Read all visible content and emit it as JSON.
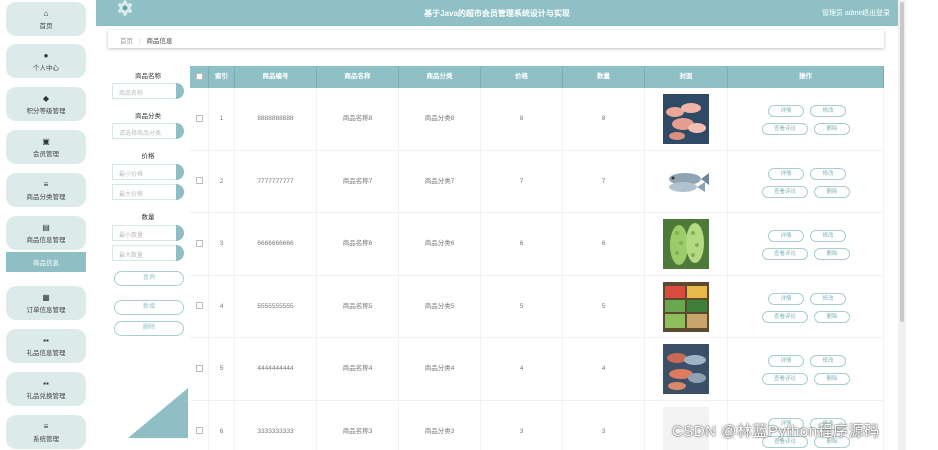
{
  "header": {
    "title": "基于Java的超市会员管理系统设计与实现",
    "user": "管理员 admin",
    "logout": "退出登录"
  },
  "sidebar": {
    "items": [
      {
        "icon": "home-icon",
        "glyph": "⌂",
        "label": "首页"
      },
      {
        "icon": "user-icon",
        "glyph": "●",
        "label": "个人中心"
      },
      {
        "icon": "points-icon",
        "glyph": "◆",
        "label": "积分等级管理"
      },
      {
        "icon": "member-icon",
        "glyph": "▣",
        "label": "会员管理"
      },
      {
        "icon": "list-icon",
        "glyph": "≡",
        "label": "商品分类管理"
      },
      {
        "icon": "goods-icon",
        "glyph": "▤",
        "label": "商品信息管理"
      },
      {
        "icon": "order-icon",
        "glyph": "▦",
        "label": "订单信息管理"
      },
      {
        "icon": "gift-icon",
        "glyph": "▪▪",
        "label": "礼品信息管理"
      },
      {
        "icon": "exchange-icon",
        "glyph": "▪▪",
        "label": "礼品兑换管理"
      },
      {
        "icon": "system-icon",
        "glyph": "≡",
        "label": "系统管理"
      }
    ],
    "active_sub": "商品信息"
  },
  "breadcrumb": {
    "home": "首页",
    "sep": "/",
    "current": "商品信息"
  },
  "search": {
    "name_label": "商品名称",
    "name_placeholder": "商品名称",
    "category_label": "商品分类",
    "category_placeholder": "请选择商品分类",
    "price_label": "价格",
    "price_min": "最小价格",
    "price_max": "最大价格",
    "qty_label": "数量",
    "qty_min": "最小数量",
    "qty_max": "最大数量",
    "query_btn": "查询",
    "add_btn": "新增",
    "delete_btn": "删除"
  },
  "table": {
    "columns": [
      "索引",
      "商品编号",
      "商品名称",
      "商品分类",
      "价格",
      "数量",
      "封面",
      "操作"
    ],
    "rows": [
      {
        "index": "1",
        "code": "8888888888",
        "name": "商品名称8",
        "category": "商品分类8",
        "price": "8",
        "qty": "8",
        "cover": "shrimp"
      },
      {
        "index": "2",
        "code": "7777777777",
        "name": "商品名称7",
        "category": "商品分类7",
        "price": "7",
        "qty": "7",
        "cover": "fish"
      },
      {
        "index": "3",
        "code": "6666666666",
        "name": "商品名称6",
        "category": "商品分类6",
        "price": "6",
        "qty": "6",
        "cover": "bittermelon"
      },
      {
        "index": "4",
        "code": "5555555555",
        "name": "商品名称5",
        "category": "商品分类5",
        "price": "5",
        "qty": "5",
        "cover": "vegetables"
      },
      {
        "index": "5",
        "code": "4444444444",
        "name": "商品名称4",
        "category": "商品分类4",
        "price": "4",
        "qty": "4",
        "cover": "seafood"
      },
      {
        "index": "6",
        "code": "3333333333",
        "name": "商品名称3",
        "category": "商品分类3",
        "price": "3",
        "qty": "3",
        "cover": "blank"
      }
    ],
    "ops": {
      "detail": "详情",
      "edit": "修改",
      "comments": "查看评论",
      "delete": "删除"
    }
  },
  "watermark": "CSDN @林蓝Python程序源码",
  "colors": {
    "accent": "#8fc0c6",
    "sidebar_bg": "#dcebea",
    "active": "#8fbfc4"
  }
}
